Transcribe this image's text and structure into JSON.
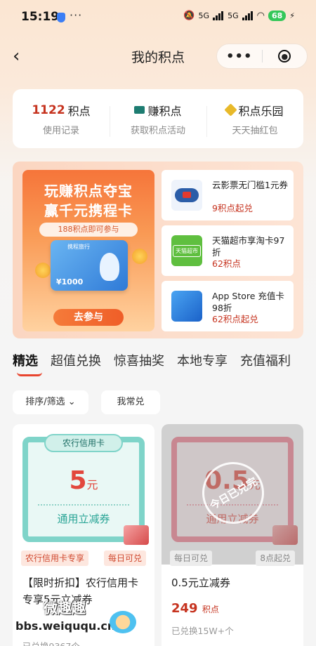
{
  "status_bar": {
    "time": "15:19",
    "dots": "···",
    "net1": "5G",
    "net2": "5G",
    "battery": "68"
  },
  "nav": {
    "title": "我的积点",
    "more": "•••"
  },
  "stats": [
    {
      "value": "1122",
      "label": "积点",
      "sub": "使用记录"
    },
    {
      "label": "赚积点",
      "sub": "获取积点活动"
    },
    {
      "label": "积点乐园",
      "sub": "天天抽红包"
    }
  ],
  "promo": {
    "banner": {
      "title1": "玩赚积点夺宝",
      "title2": "赢千元携程卡",
      "pill": "188积点即可参与",
      "card_bank": "携程旅行",
      "card_amount": "¥1000",
      "button": "去参与"
    },
    "items": [
      {
        "name": "云影票无门槛1元券",
        "price": "9积点起兑",
        "icon": "cloud-movie-icon"
      },
      {
        "name": "天猫超市享淘卡97折",
        "price": "62积点",
        "icon": "tmall-icon",
        "icon_text": "天猫超市"
      },
      {
        "name": "App Store 充值卡98折",
        "price": "62积点起兑",
        "icon": "apple-icon"
      }
    ]
  },
  "tabs": [
    "精选",
    "超值兑换",
    "惊喜抽奖",
    "本地专享",
    "充值福利"
  ],
  "filters": {
    "sort": "排序/筛选",
    "frequent": "我常兑"
  },
  "products": [
    {
      "coupon_label": "农行信用卡",
      "amount": "5",
      "unit": "元",
      "coupon_foot": "通用立减券",
      "tags": [
        "农行信用卡专享",
        "每日可兑"
      ],
      "title": "【限时折扣】农行信用卡专享5元立减券",
      "sold": "已兑换9367个"
    },
    {
      "amount": "0.5",
      "unit": "元",
      "coupon_foot": "通用立减券",
      "stamp": "今日已兑完",
      "tags": [
        "每日可兑",
        "8点起兑"
      ],
      "title": "0.5元立减券",
      "price": "249",
      "price_unit": "积点",
      "sold": "已兑换15W+个"
    }
  ],
  "watermark": {
    "cn": "微趣趣",
    "url": "bbs.weiququ.cn"
  },
  "colors": {
    "accent_red": "#c6331f",
    "tab_underline": "#e8452f",
    "coupon_green": "#7fd4c9",
    "coupon_red": "#f07a8c"
  }
}
